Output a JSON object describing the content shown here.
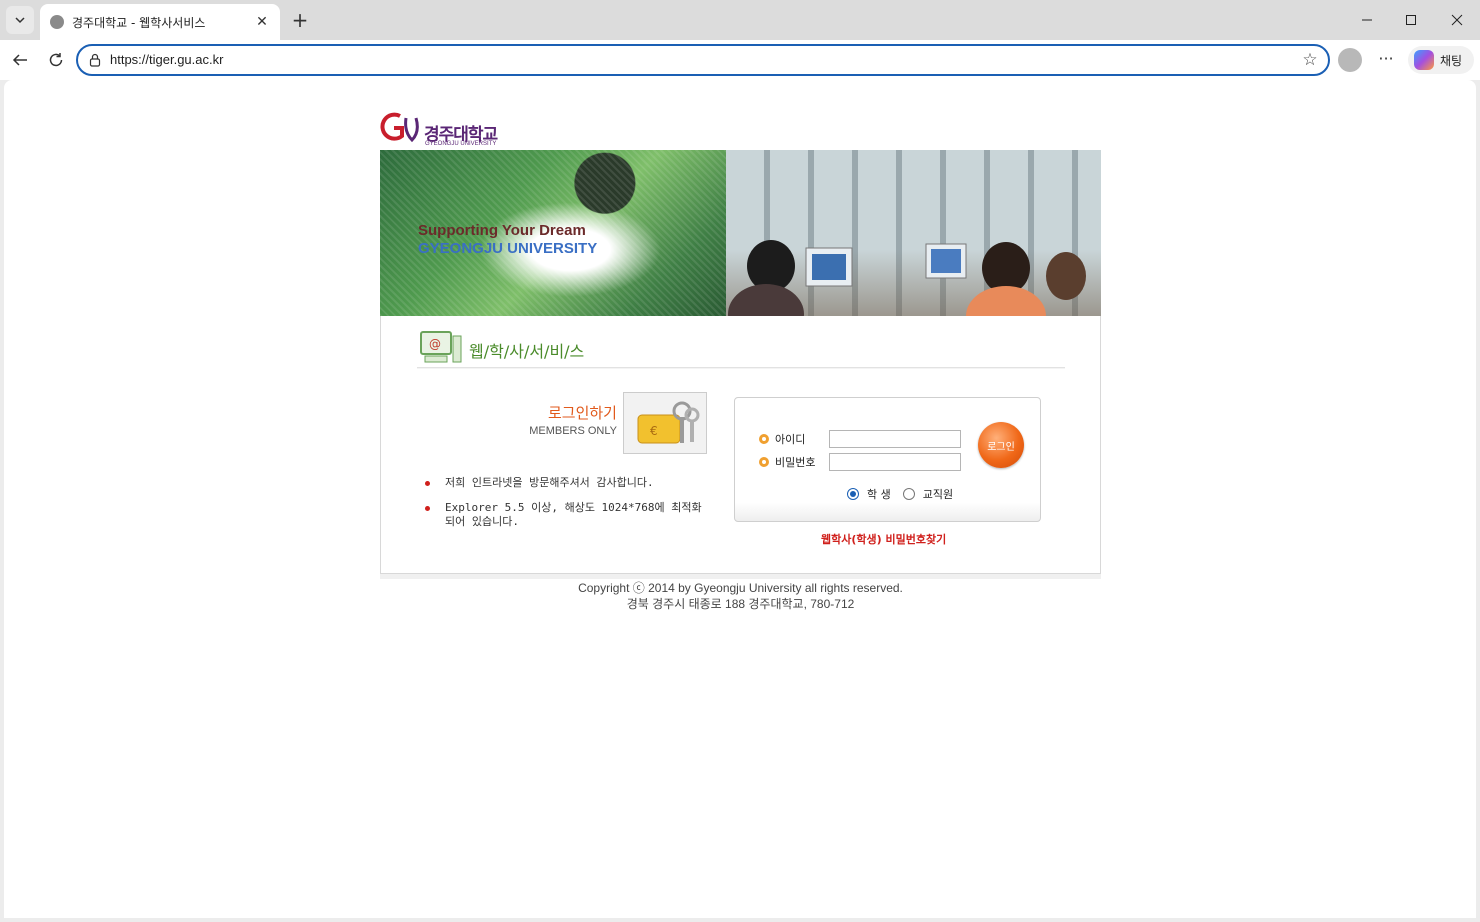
{
  "browser": {
    "tab_title": "경주대학교 - 웹학사서비스",
    "url": "https://tiger.gu.ac.kr",
    "copilot_label": "채팅"
  },
  "logo": {
    "name": "경주대학교",
    "sub": "GYEONGJU UNIVERSITY"
  },
  "banner": {
    "tagline1": "Supporting Your Dream",
    "tagline2": "GYEONGJU UNIVERSITY"
  },
  "service": {
    "title": "웹/학/사/서/비/스"
  },
  "login": {
    "heading": "로그인하기",
    "subheading": "MEMBERS ONLY",
    "id_label": "아이디",
    "password_label": "비밀번호",
    "id_value": "",
    "password_value": "",
    "login_button": "로그인",
    "radio_options": [
      "학 생",
      "교직원"
    ],
    "selected_radio": "학 생",
    "find_password": "웹학사(학생) 비밀번호찾기"
  },
  "notices": [
    "저희 인트라넷을 방문해주셔서 감사합니다.",
    "Explorer 5.5 이상, 해상도 1024*768에 최적화\n되어 있습니다."
  ],
  "footer": {
    "copyright": "Copyright ⓒ 2014 by Gyeongju University all rights reserved.",
    "address": "경북 경주시 태종로 188 경주대학교, 780-712"
  },
  "colors": {
    "accent_orange": "#e15a1c",
    "service_green": "#4a8b2a",
    "alert_red": "#d0201c",
    "brand_purple": "#5a2675"
  }
}
